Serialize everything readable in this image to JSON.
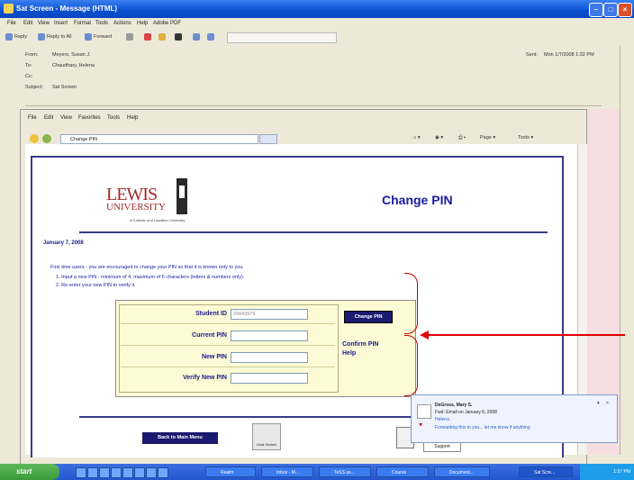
{
  "window": {
    "title": "Sat Screen - Message (HTML)"
  },
  "menu": [
    "File",
    "Edit",
    "View",
    "Insert",
    "Format",
    "Tools",
    "Actions",
    "Help",
    "Adobe PDF"
  ],
  "toolbar": {
    "reply": "Reply",
    "reply_all": "Reply to All",
    "forward": "Forward"
  },
  "header": {
    "from_label": "From:",
    "from_value": "Meyers, Susan J.",
    "to_label": "To:",
    "to_value": "Chaudhary, Helena",
    "cc_label": "Cc:",
    "subject_label": "Subject:",
    "subject_value": "Sat Screen",
    "sent_label": "Sent:",
    "sent_value": "Mon 1/7/2008 1:32 PM"
  },
  "browser": {
    "menu": [
      "File",
      "Edit",
      "View",
      "Favorites",
      "Tools",
      "Help"
    ],
    "address": "Change PIN",
    "page_menu": "Page ▾",
    "tools_menu": "Tools ▾"
  },
  "page": {
    "logo_top": "LEWIS",
    "logo_bottom": "UNIVERSITY",
    "logo_tagline": "A Catholic and Lasallian University",
    "title": "Change PIN",
    "date": "January 7, 2008",
    "intro": "First time users - you are encouraged to change your PIN so that it is known only to you.",
    "steps": [
      "1. Input a new PIN - minimum of 4, maximum of 6 characters (letters & numbers only).",
      "2. Re-enter your new PIN to verify it."
    ],
    "form": {
      "student_id_label": "Student ID",
      "student_id_value": "20043979",
      "current_pin_label": "Current PIN",
      "new_pin_label": "New PIN",
      "verify_pin_label": "Verify New PIN",
      "change_button": "Change PIN",
      "confirm_help": "Confirm PIN",
      "help": "Help"
    },
    "back_button": "Back to Main Menu",
    "icon_caption": "Goal Seeker",
    "support_tab": "Support"
  },
  "notification": {
    "name": "DeGross, Mary S.",
    "line1": "Fwd: Email on January 6, 2008",
    "line2": "Helena",
    "line3": "Forwarding this to you... let me know if anything"
  },
  "taskbar": {
    "start": "start",
    "tasks": [
      "Realm",
      "Inbox - M...",
      "TeSS us...",
      "Course",
      "Document...",
      "Sat Scre..."
    ],
    "clock": "1:37 PM"
  }
}
